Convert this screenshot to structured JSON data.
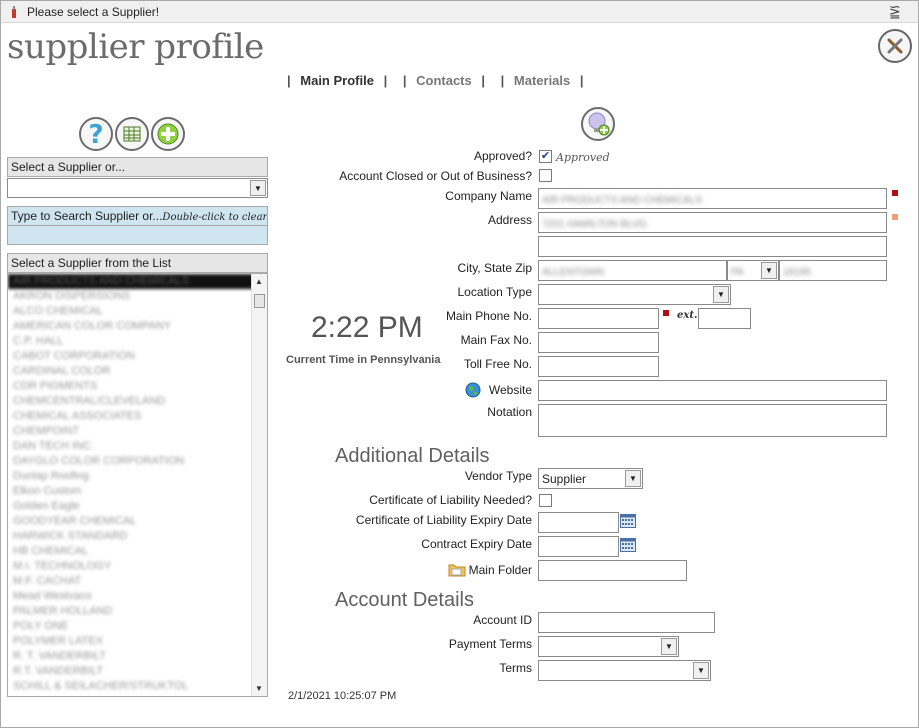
{
  "window": {
    "title": "Please select a Supplier!",
    "close_glyph": "⪠"
  },
  "header": {
    "title": "supplier profile"
  },
  "tabs": [
    {
      "label": "Main Profile",
      "active": true
    },
    {
      "label": "Contacts",
      "active": false
    },
    {
      "label": "Materials",
      "active": false
    }
  ],
  "left_panel": {
    "select_supplier_label": "Select a Supplier or...",
    "search_label": "Type to Search Supplier or...",
    "search_hint": "Double-click to clear",
    "search_value": "",
    "list_label": "Select a Supplier from the List",
    "suppliers": [
      "AIR PRODUCTS AND CHEMICALS",
      "AKRON DISPERSIONS",
      "ALCO CHEMICAL",
      "AMERICAN COLOR COMPANY",
      "C.P. HALL",
      "CABOT CORPORATION",
      "CARDINAL COLOR",
      "CDR PIGMENTS",
      "CHEMCENTRAL/CLEVELAND",
      "CHEMICAL ASSOCIATES",
      "CHEMPOINT",
      "DAN TECH INC.",
      "DAYGLO COLOR CORPORATION",
      "Dunlap Roofing",
      "Elkon Custom",
      "Golden Eagle",
      "GOODYEAR CHEMICAL",
      "HARWICK STANDARD",
      "HB CHEMICAL",
      "M.I. TECHNOLOGY",
      "M.F. CACHAT",
      "Mead Westvaco",
      "PALMER HOLLAND",
      "POLY ONE",
      "POLYMER LATEX",
      "R. T. VANDERBILT",
      "R.T. VANDERBILT",
      "SCHILL & SEILACHER/STRUKTOL"
    ]
  },
  "clock": {
    "time": "2:22 PM",
    "label": "Current Time in Pennsylvania"
  },
  "form": {
    "approved_label": "Approved?",
    "approved_checked": true,
    "approved_note": "Approved",
    "closed_label": "Account Closed or Out of Business?",
    "closed_checked": false,
    "company_name_label": "Company Name",
    "company_name_value": "AIR PRODUCTS AND CHEMICALS",
    "address_label": "Address",
    "address_line1": "7201 HAMILTON BLVD.",
    "address_line2": "",
    "city_state_zip_label": "City, State  Zip",
    "city_value": "ALLENTOWN",
    "state_value": "PA",
    "zip_value": "18195",
    "location_type_label": "Location Type",
    "location_type_value": "",
    "main_phone_label": "Main Phone No.",
    "main_phone_value": "",
    "ext_label": "ext.",
    "ext_value": "",
    "main_fax_label": "Main Fax No.",
    "main_fax_value": "",
    "toll_free_label": "Toll Free No.",
    "toll_free_value": "",
    "website_label": "Website",
    "website_value": "",
    "notation_label": "Notation",
    "notation_value": ""
  },
  "additional": {
    "heading": "Additional Details",
    "vendor_type_label": "Vendor Type",
    "vendor_type_value": "Supplier",
    "cert_needed_label": "Certificate of Liability Needed?",
    "cert_needed_checked": false,
    "cert_expiry_label": "Certificate of Liability Expiry Date",
    "cert_expiry_value": "",
    "contract_expiry_label": "Contract Expiry Date",
    "contract_expiry_value": "",
    "main_folder_label": "Main Folder",
    "main_folder_value": ""
  },
  "account": {
    "heading": "Account Details",
    "account_id_label": "Account ID",
    "account_id_value": "",
    "payment_terms_label": "Payment Terms",
    "payment_terms_value": "",
    "terms_label": "Terms",
    "terms_value": ""
  },
  "footer": {
    "timestamp": "2/1/2021 10:25:07 PM"
  },
  "colors": {
    "required_marker": "#b01010",
    "optional_marker": "#f0a070",
    "search_bg": "#cfe6f0"
  },
  "icons": {
    "help": "help-icon",
    "grid": "spreadsheet-icon",
    "add": "add-icon",
    "idea": "lightbulb-add-icon",
    "close": "close-tools-icon",
    "globe": "globe-icon",
    "folder": "folder-icon",
    "calendar": "calendar-icon"
  }
}
